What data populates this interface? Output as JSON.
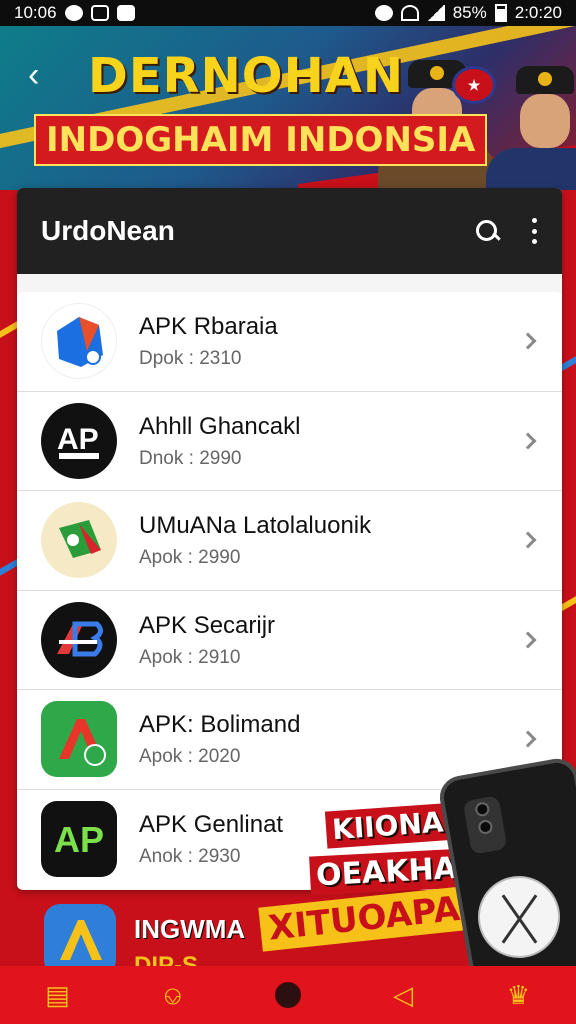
{
  "status_bar": {
    "time_left": "10:06",
    "battery": "85%",
    "time_right": "2:0:20"
  },
  "banner": {
    "title": "DERNOHAN",
    "subtitle": "INDOGHAIM INDONSIA"
  },
  "toolbar": {
    "title": "UrdoNean"
  },
  "apps": [
    {
      "name": "APK Rbaraia",
      "version": "Dpok : 2310",
      "icon": "app-icon-blue-droplet",
      "bg": "#ffffff",
      "fg": "#1c6fe0"
    },
    {
      "name": "Ahhll Ghancakl",
      "version": "Dnok : 2990",
      "icon": "app-icon-ap-black",
      "bg": "#111111",
      "fg": "#ffffff"
    },
    {
      "name": "UMuANa Latolaluonik",
      "version": "Apok : 2990",
      "icon": "app-icon-green-red-cone",
      "bg": "#f6e9c6",
      "fg": "#2a9d3a"
    },
    {
      "name": "APK Secarijr",
      "version": "Apok : 2910",
      "icon": "app-icon-ab-black",
      "bg": "#111111",
      "fg": "#ffffff"
    },
    {
      "name": "APK: Bolimand",
      "version": "Apok : 2020",
      "icon": "app-icon-green-a",
      "bg": "#2fa84a",
      "fg": "#ffffff"
    },
    {
      "name": "APK Genlinat",
      "version": "Anok : 2930",
      "icon": "app-icon-ap-square",
      "bg": "#111111",
      "fg": "#7be04a"
    }
  ],
  "promo": {
    "line1": "KIIONAMI",
    "line2": "OEAKHAN",
    "line3": "XITUOAPA!"
  },
  "peek_app": {
    "name": "INGWMA",
    "name2": "DIP-S"
  }
}
